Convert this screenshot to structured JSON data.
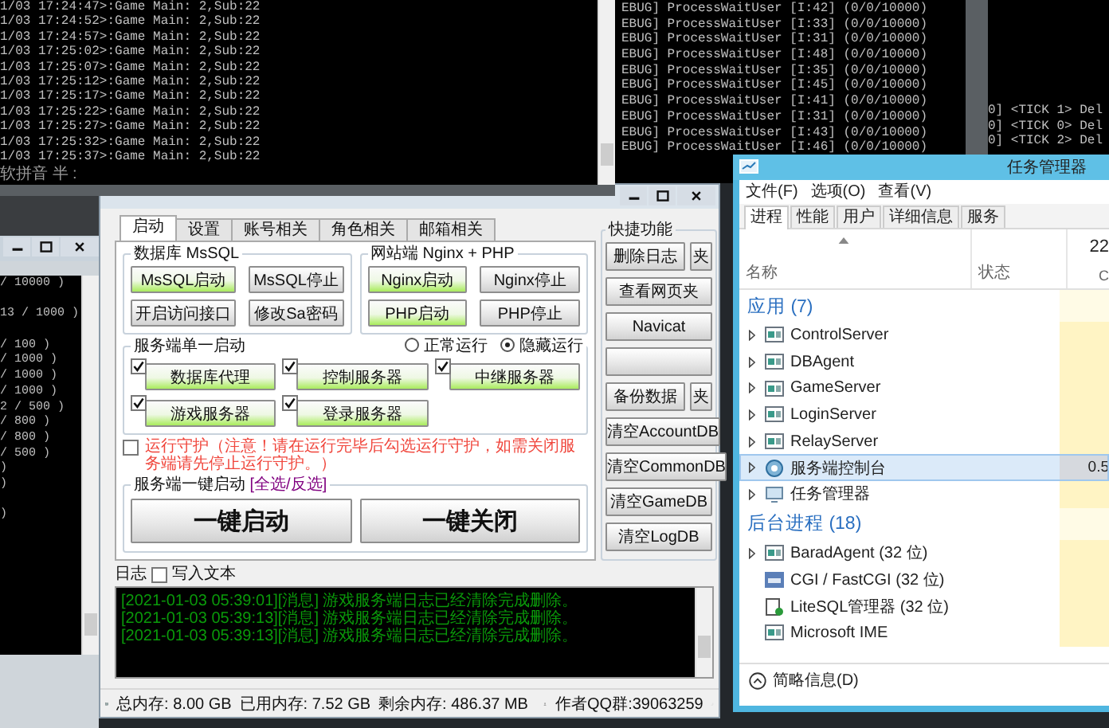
{
  "console_log": {
    "lines": [
      "1/03 17:24:47>:Game Main: 2,Sub:22",
      "1/03 17:24:52>:Game Main: 2,Sub:22",
      "1/03 17:24:57>:Game Main: 2,Sub:22",
      "1/03 17:25:02>:Game Main: 2,Sub:22",
      "1/03 17:25:07>:Game Main: 2,Sub:22",
      "1/03 17:25:12>:Game Main: 2,Sub:22",
      "1/03 17:25:17>:Game Main: 2,Sub:22",
      "1/03 17:25:22>:Game Main: 2,Sub:22",
      "1/03 17:25:27>:Game Main: 2,Sub:22",
      "1/03 17:25:32>:Game Main: 2,Sub:22",
      "1/03 17:25:37>:Game Main: 2,Sub:22"
    ],
    "ime_status": "软拼音 半 :"
  },
  "side_console": {
    "blocks": [
      [
        "/ 10000 )"
      ],
      [
        "13 / 1000 )"
      ],
      [
        "/ 100 )",
        "/ 1000 )",
        "/ 1000 )",
        "/ 1000 )",
        "2 / 500 )",
        "/ 800 )",
        "/ 800 )",
        "/ 500 )",
        ")",
        ")"
      ],
      [
        ")"
      ]
    ]
  },
  "server_console": {
    "lines": [
      "EBUG] ProcessWaitUser [I:42] (0/0/10000)",
      "EBUG] ProcessWaitUser [I:33] (0/0/10000)",
      "EBUG] ProcessWaitUser [I:31] (0/0/10000)",
      "EBUG] ProcessWaitUser [I:48] (0/0/10000)",
      "EBUG] ProcessWaitUser [I:35] (0/0/10000)",
      "EBUG] ProcessWaitUser [I:45] (0/0/10000)",
      "EBUG] ProcessWaitUser [I:41] (0/0/10000)",
      "EBUG] ProcessWaitUser [I:31] (0/0/10000)",
      "EBUG] ProcessWaitUser [I:43] (0/0/10000)",
      "EBUG] ProcessWaitUser [I:46] (0/0/10000)"
    ]
  },
  "tick_console": {
    "lines": [
      "0] <TICK 1> Del",
      "0] <TICK 0> Del",
      "0] <TICK 2> Del"
    ]
  },
  "control_panel": {
    "tabs": [
      {
        "label": "启动",
        "selected": true
      },
      {
        "label": "设置",
        "selected": false
      },
      {
        "label": "账号相关",
        "selected": false
      },
      {
        "label": "角色相关",
        "selected": false
      },
      {
        "label": "邮箱相关",
        "selected": false
      }
    ],
    "groups": [
      {
        "title": "数据库 MsSQL",
        "buttons": [
          {
            "label": "MsSQL启动",
            "active": true
          },
          {
            "label": "MsSQL停止",
            "active": false
          },
          {
            "label": "开启访问接口",
            "active": false
          },
          {
            "label": "修改Sa密码",
            "active": false
          }
        ]
      },
      {
        "title": "网站端 Nginx + PHP",
        "buttons": [
          {
            "label": "Nginx启动",
            "active": true
          },
          {
            "label": "Nginx停止",
            "active": false
          },
          {
            "label": "PHP启动",
            "active": true
          },
          {
            "label": "PHP停止",
            "active": false
          }
        ]
      }
    ],
    "single_start": {
      "title": "服务端单一启动",
      "modes": [
        {
          "label": "正常运行",
          "selected": false
        },
        {
          "label": "隐藏运行",
          "selected": true
        }
      ],
      "servers": [
        {
          "label": "数据库代理",
          "checked": true,
          "active": true
        },
        {
          "label": "控制服务器",
          "checked": true,
          "active": true
        },
        {
          "label": "中继服务器",
          "checked": true,
          "active": true
        },
        {
          "label": "游戏服务器",
          "checked": true,
          "active": true
        },
        {
          "label": "登录服务器",
          "checked": true,
          "active": true
        }
      ]
    },
    "guard": {
      "label": "运行守护（注意！请在运行完毕后勾选运行守护，如需关闭服务端请先停止运行守护。）",
      "checked": false
    },
    "one_key": {
      "title": "服务端一键启动",
      "toggle_link": "[全选/反选]",
      "buttons": [
        "一键启动",
        "一键关闭"
      ]
    },
    "quick": {
      "title": "快捷功能",
      "buttons": [
        {
          "kind": "pair",
          "label": "删除日志",
          "side_label": "夹"
        },
        {
          "kind": "single",
          "label": "查看网页夹"
        },
        {
          "kind": "single",
          "label": "Navicat"
        },
        {
          "kind": "blank"
        },
        {
          "kind": "pair",
          "label": "备份数据",
          "side_label": "夹"
        },
        {
          "kind": "single",
          "label": "清空AccountDB"
        },
        {
          "kind": "single",
          "label": "清空CommonDB"
        },
        {
          "kind": "single",
          "label": "清空GameDB"
        },
        {
          "kind": "single",
          "label": "清空LogDB"
        }
      ]
    },
    "log": {
      "label": "日志",
      "write_text": {
        "label": "写入文本",
        "checked": false
      },
      "lines": [
        "[2021-01-03 05:39:01][消息] 游戏服务端日志已经清除完成删除。",
        "[2021-01-03 05:39:13][消息] 游戏服务端日志已经清除完成删除。",
        "[2021-01-03 05:39:13][消息] 游戏服务端日志已经清除完成删除。"
      ]
    },
    "status_bar": {
      "memory": [
        "总内存: 8.00 GB",
        "已用内存: 7.52 GB",
        "剩余内存: 486.37 MB"
      ],
      "qq_group": "作者QQ群:39063259"
    }
  },
  "task_manager": {
    "title": "任务管理器",
    "menu": [
      "文件(F)",
      "选项(O)",
      "查看(V)"
    ],
    "tabs": [
      {
        "label": "进程",
        "selected": true
      },
      {
        "label": "性能",
        "selected": false
      },
      {
        "label": "用户",
        "selected": false
      },
      {
        "label": "详细信息",
        "selected": false
      },
      {
        "label": "服务",
        "selected": false
      }
    ],
    "columns": {
      "name": "名称",
      "status": "状态",
      "cpu_percent": "22",
      "cpu_label": "C"
    },
    "groups": [
      {
        "title": "应用 (7)",
        "rows": [
          {
            "name": "ControlServer",
            "kind": "app",
            "expandable": true,
            "selected": false
          },
          {
            "name": "DBAgent",
            "kind": "app",
            "expandable": true,
            "selected": false
          },
          {
            "name": "GameServer",
            "kind": "app",
            "expandable": true,
            "selected": false
          },
          {
            "name": "LoginServer",
            "kind": "app",
            "expandable": true,
            "selected": false
          },
          {
            "name": "RelayServer",
            "kind": "app",
            "expandable": true,
            "selected": false
          },
          {
            "name": "服务端控制台",
            "kind": "console",
            "expandable": true,
            "selected": true,
            "cpu": "0.5"
          },
          {
            "name": "任务管理器",
            "kind": "monitor",
            "expandable": true,
            "selected": false
          }
        ]
      },
      {
        "title": "后台进程 (18)",
        "rows": [
          {
            "name": "BaradAgent (32 位)",
            "kind": "app",
            "expandable": true,
            "selected": false
          },
          {
            "name": "CGI / FastCGI (32 位)",
            "kind": "cgi",
            "expandable": false,
            "selected": false
          },
          {
            "name": "LiteSQL管理器 (32 位)",
            "kind": "tool",
            "expandable": false,
            "selected": false
          },
          {
            "name": "Microsoft IME",
            "kind": "app",
            "expandable": false,
            "selected": false
          }
        ]
      }
    ],
    "footer": "简略信息(D)"
  }
}
